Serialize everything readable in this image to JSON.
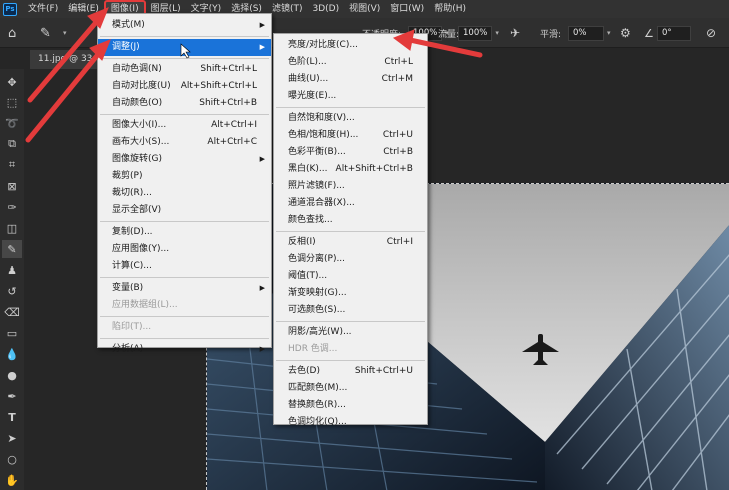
{
  "app": {
    "logo": "Ps"
  },
  "menubar": [
    "文件(F)",
    "编辑(E)",
    "图像(I)",
    "图层(L)",
    "文字(Y)",
    "选择(S)",
    "滤镜(T)",
    "3D(D)",
    "视图(V)",
    "窗口(W)",
    "帮助(H)"
  ],
  "options": {
    "brush_size": "40",
    "opacity_label": "不透明度:",
    "opacity_value": "100%",
    "flow_label": "流量:",
    "flow_value": "100%",
    "smooth_label": "平滑:",
    "smooth_value": "0%",
    "angle_value": "0°"
  },
  "document": {
    "tab_label": "11.jpg @ 33"
  },
  "image_menu": [
    {
      "label": "模式(M)",
      "shortcut": "",
      "submenu": true
    },
    {
      "sep": true
    },
    {
      "label": "调整(J)",
      "shortcut": "",
      "submenu": true,
      "highlighted": true
    },
    {
      "sep": true
    },
    {
      "label": "自动色调(N)",
      "shortcut": "Shift+Ctrl+L"
    },
    {
      "label": "自动对比度(U)",
      "shortcut": "Alt+Shift+Ctrl+L"
    },
    {
      "label": "自动颜色(O)",
      "shortcut": "Shift+Ctrl+B"
    },
    {
      "sep": true
    },
    {
      "label": "图像大小(I)...",
      "shortcut": "Alt+Ctrl+I"
    },
    {
      "label": "画布大小(S)...",
      "shortcut": "Alt+Ctrl+C"
    },
    {
      "label": "图像旋转(G)",
      "shortcut": "",
      "submenu": true
    },
    {
      "label": "裁剪(P)",
      "shortcut": ""
    },
    {
      "label": "裁切(R)...",
      "shortcut": ""
    },
    {
      "label": "显示全部(V)",
      "shortcut": ""
    },
    {
      "sep": true
    },
    {
      "label": "复制(D)...",
      "shortcut": ""
    },
    {
      "label": "应用图像(Y)...",
      "shortcut": ""
    },
    {
      "label": "计算(C)...",
      "shortcut": ""
    },
    {
      "sep": true
    },
    {
      "label": "变量(B)",
      "shortcut": "",
      "submenu": true
    },
    {
      "label": "应用数据组(L)...",
      "shortcut": "",
      "disabled": true
    },
    {
      "sep": true
    },
    {
      "label": "陷印(T)...",
      "shortcut": "",
      "disabled": true
    },
    {
      "sep": true
    },
    {
      "label": "分析(A)",
      "shortcut": "",
      "submenu": true
    }
  ],
  "adjust_menu": [
    {
      "label": "亮度/对比度(C)...",
      "shortcut": ""
    },
    {
      "label": "色阶(L)...",
      "shortcut": "Ctrl+L"
    },
    {
      "label": "曲线(U)...",
      "shortcut": "Ctrl+M"
    },
    {
      "label": "曝光度(E)...",
      "shortcut": ""
    },
    {
      "sep": true
    },
    {
      "label": "自然饱和度(V)...",
      "shortcut": ""
    },
    {
      "label": "色相/饱和度(H)...",
      "shortcut": "Ctrl+U"
    },
    {
      "label": "色彩平衡(B)...",
      "shortcut": "Ctrl+B"
    },
    {
      "label": "黑白(K)...",
      "shortcut": "Alt+Shift+Ctrl+B"
    },
    {
      "label": "照片滤镜(F)...",
      "shortcut": ""
    },
    {
      "label": "通道混合器(X)...",
      "shortcut": ""
    },
    {
      "label": "颜色查找...",
      "shortcut": ""
    },
    {
      "sep": true
    },
    {
      "label": "反相(I)",
      "shortcut": "Ctrl+I"
    },
    {
      "label": "色调分离(P)...",
      "shortcut": ""
    },
    {
      "label": "阈值(T)...",
      "shortcut": ""
    },
    {
      "label": "渐变映射(G)...",
      "shortcut": ""
    },
    {
      "label": "可选颜色(S)...",
      "shortcut": ""
    },
    {
      "sep": true
    },
    {
      "label": "阴影/高光(W)...",
      "shortcut": ""
    },
    {
      "label": "HDR 色调...",
      "shortcut": "",
      "disabled": true
    },
    {
      "sep": true
    },
    {
      "label": "去色(D)",
      "shortcut": "Shift+Ctrl+U"
    },
    {
      "label": "匹配颜色(M)...",
      "shortcut": ""
    },
    {
      "label": "替换颜色(R)...",
      "shortcut": ""
    },
    {
      "label": "色调均化(Q)...",
      "shortcut": ""
    }
  ],
  "colors": {
    "highlight": "#1a73d9",
    "annotation": "#e33b3b"
  }
}
